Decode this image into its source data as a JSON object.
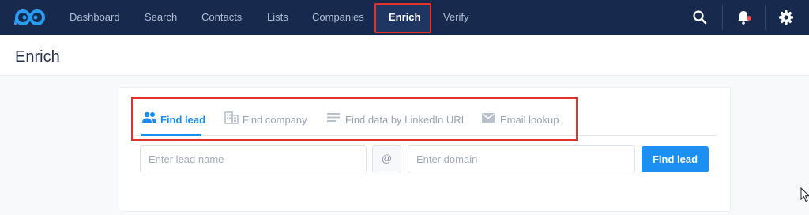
{
  "nav": {
    "items": [
      {
        "label": "Dashboard"
      },
      {
        "label": "Search"
      },
      {
        "label": "Contacts"
      },
      {
        "label": "Lists"
      },
      {
        "label": "Companies"
      },
      {
        "label": "Enrich",
        "active": true
      },
      {
        "label": "Verify"
      }
    ],
    "icons": [
      "search-icon",
      "bell-icon",
      "gear-icon"
    ]
  },
  "page": {
    "title": "Enrich"
  },
  "enrich": {
    "tabs": [
      {
        "label": "Find lead",
        "icon": "people-icon",
        "active": true
      },
      {
        "label": "Find company",
        "icon": "building-icon"
      },
      {
        "label": "Find data by LinkedIn URL",
        "icon": "lines-icon"
      },
      {
        "label": "Email lookup",
        "icon": "envelope-icon"
      }
    ],
    "form": {
      "lead_placeholder": "Enter lead name",
      "at_symbol": "@",
      "domain_placeholder": "Enter domain",
      "submit_label": "Find lead"
    }
  },
  "colors": {
    "nav_bg": "#172a4d",
    "accent": "#1c8ff2",
    "highlight": "#e0332c",
    "notification": "#ef4f52"
  }
}
